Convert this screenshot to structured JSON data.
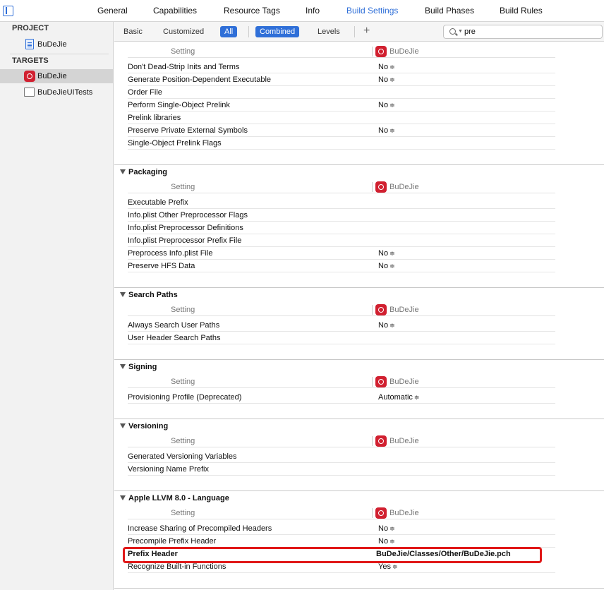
{
  "tabs": [
    "General",
    "Capabilities",
    "Resource Tags",
    "Info",
    "Build Settings",
    "Build Phases",
    "Build Rules"
  ],
  "active_tab": "Build Settings",
  "sidebar": {
    "project_header": "PROJECT",
    "project_item": "BuDeJie",
    "targets_header": "TARGETS",
    "target_items": [
      "BuDeJie",
      "BuDeJieUITests"
    ]
  },
  "filters": {
    "basic": "Basic",
    "customized": "Customized",
    "all": "All",
    "combined": "Combined",
    "levels": "Levels",
    "add": "+",
    "search_value": "pre"
  },
  "column_header": {
    "setting": "Setting",
    "target": "BuDeJie"
  },
  "top_rows": [
    {
      "name": "Don't Dead-Strip Inits and Terms",
      "value": "No"
    },
    {
      "name": "Generate Position-Dependent Executable",
      "value": "No"
    },
    {
      "name": "Order File",
      "value": ""
    },
    {
      "name": "Perform Single-Object Prelink",
      "value": "No"
    },
    {
      "name": "Prelink libraries",
      "value": ""
    },
    {
      "name": "Preserve Private External Symbols",
      "value": "No"
    },
    {
      "name": "Single-Object Prelink Flags",
      "value": ""
    }
  ],
  "sections": [
    {
      "title": "Packaging",
      "rows": [
        {
          "name": "Executable Prefix",
          "value": ""
        },
        {
          "name": "Info.plist Other Preprocessor Flags",
          "value": ""
        },
        {
          "name": "Info.plist Preprocessor Definitions",
          "value": ""
        },
        {
          "name": "Info.plist Preprocessor Prefix File",
          "value": ""
        },
        {
          "name": "Preprocess Info.plist File",
          "value": "No"
        },
        {
          "name": "Preserve HFS Data",
          "value": "No"
        }
      ]
    },
    {
      "title": "Search Paths",
      "rows": [
        {
          "name": "Always Search User Paths",
          "value": "No"
        },
        {
          "name": "User Header Search Paths",
          "value": ""
        }
      ]
    },
    {
      "title": "Signing",
      "rows": [
        {
          "name": "Provisioning Profile (Deprecated)",
          "value": "Automatic"
        }
      ]
    },
    {
      "title": "Versioning",
      "rows": [
        {
          "name": "Generated Versioning Variables",
          "value": ""
        },
        {
          "name": "Versioning Name Prefix",
          "value": ""
        }
      ]
    },
    {
      "title": "Apple LLVM 8.0 - Language",
      "rows": [
        {
          "name": "Increase Sharing of Precompiled Headers",
          "value": "No"
        },
        {
          "name": "Precompile Prefix Header",
          "value": "No"
        },
        {
          "name": "Prefix Header",
          "value": "BuDeJie/Classes/Other/BuDeJie.pch"
        },
        {
          "name": "Recognize Built-in Functions",
          "value": "Yes"
        }
      ]
    }
  ]
}
